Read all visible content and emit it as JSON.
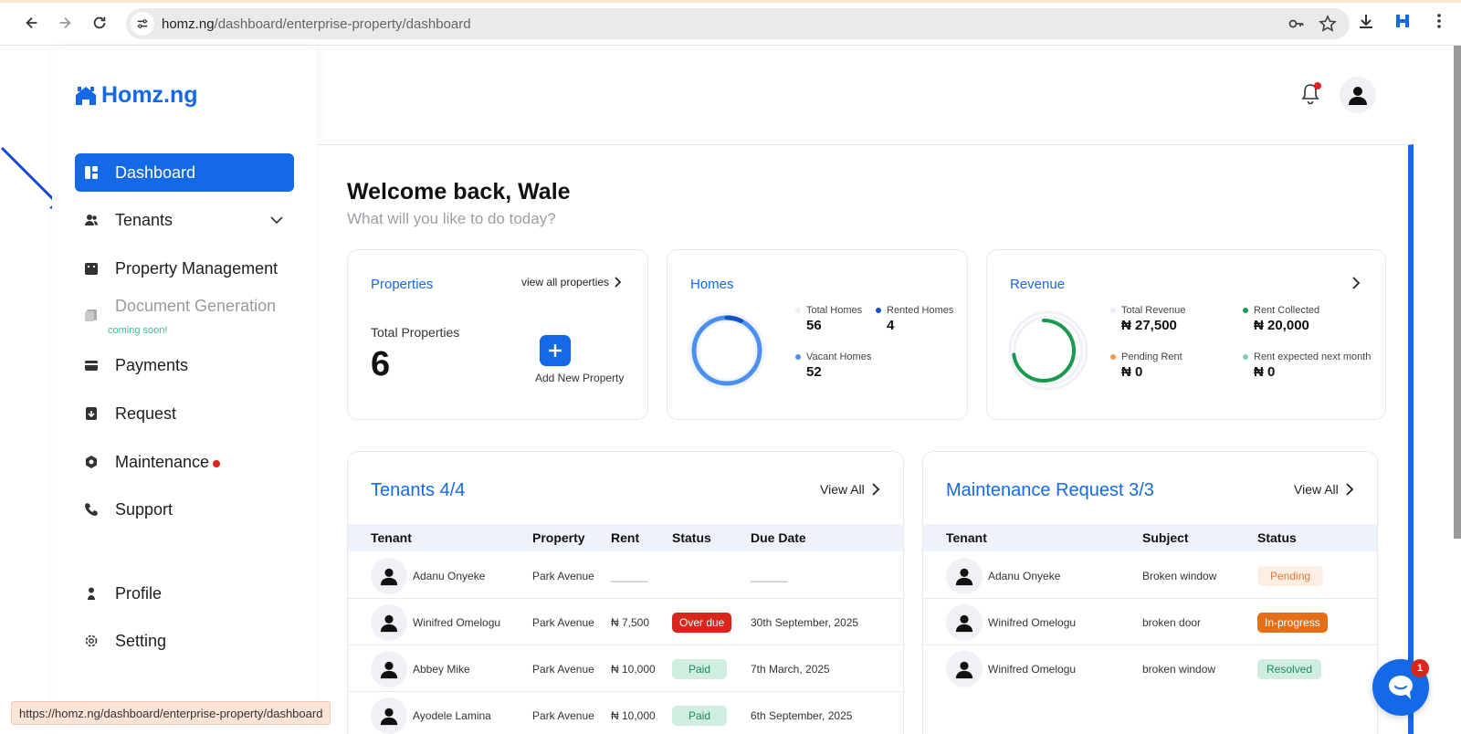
{
  "browser": {
    "url_host": "homz.ng",
    "url_path": "/dashboard/enterprise-property/dashboard",
    "status_url": "https://homz.ng/dashboard/enterprise-property/dashboard"
  },
  "sidebar": {
    "logo": "Homz.ng",
    "items": [
      {
        "label": "Dashboard",
        "icon": "dashboard-icon"
      },
      {
        "label": "Tenants",
        "icon": "users-icon"
      },
      {
        "label": "Property Management",
        "icon": "building-icon"
      },
      {
        "label": "Document Generation",
        "icon": "document-icon"
      },
      {
        "label": "Payments",
        "icon": "card-icon"
      },
      {
        "label": "Request",
        "icon": "request-icon"
      },
      {
        "label": "Maintenance",
        "icon": "maintenance-icon"
      },
      {
        "label": "Support",
        "icon": "phone-icon"
      },
      {
        "label": "Profile",
        "icon": "user-icon"
      },
      {
        "label": "Setting",
        "icon": "gear-icon"
      }
    ],
    "coming_soon": "coming soon!"
  },
  "welcome": {
    "title": "Welcome back, Wale",
    "subtitle": "What will you like to do today?"
  },
  "properties_card": {
    "title": "Properties",
    "link": "view all properties",
    "label": "Total Properties",
    "value": "6",
    "add_label": "Add New Property"
  },
  "homes_card": {
    "title": "Homes",
    "total_label": "Total Homes",
    "total_value": "56",
    "rented_label": "Rented Homes",
    "rented_value": "4",
    "vacant_label": "Vacant Homes",
    "vacant_value": "52",
    "rented_fraction": 0.071
  },
  "revenue_card": {
    "title": "Revenue",
    "total_label": "Total Revenue",
    "total_value": "₦ 27,500",
    "collected_label": "Rent Collected",
    "collected_value": "₦ 20,000",
    "pending_label": "Pending Rent",
    "pending_value": "₦ 0",
    "expected_label": "Rent expected next month",
    "expected_value": "₦ 0",
    "collected_fraction": 0.727
  },
  "tenants_table": {
    "title": "Tenants 4/4",
    "view_all": "View All",
    "headers": [
      "Tenant",
      "Property",
      "Rent",
      "Status",
      "Due Date"
    ],
    "rows": [
      {
        "tenant": "Adanu Onyeke",
        "property": "Park Avenue",
        "rent": "______",
        "status": "",
        "due": "______"
      },
      {
        "tenant": "Winifred Omelogu",
        "property": "Park Avenue",
        "rent": "₦ 7,500",
        "status": "Over due",
        "due": "30th September, 2025"
      },
      {
        "tenant": "Abbey Mike",
        "property": "Park Avenue",
        "rent": "₦ 10,000",
        "status": "Paid",
        "due": "7th March, 2025"
      },
      {
        "tenant": "Ayodele Lamina",
        "property": "Park Avenue",
        "rent": "₦ 10,000",
        "status": "Paid",
        "due": "6th September, 2025"
      }
    ]
  },
  "maintenance_table": {
    "title": "Maintenance Request 3/3",
    "view_all": "View All",
    "headers": [
      "Tenant",
      "Subject",
      "Status"
    ],
    "rows": [
      {
        "tenant": "Adanu Onyeke",
        "subject": "Broken window",
        "status": "Pending"
      },
      {
        "tenant": "Winifred Omelogu",
        "subject": "broken door",
        "status": "In-progress"
      },
      {
        "tenant": "Winifred Omelogu",
        "subject": "broken window",
        "status": "Resolved"
      }
    ]
  },
  "chat": {
    "badge": "1"
  },
  "colors": {
    "accent": "#1469e6",
    "danger": "#d8261c",
    "success": "#1f8a57"
  }
}
